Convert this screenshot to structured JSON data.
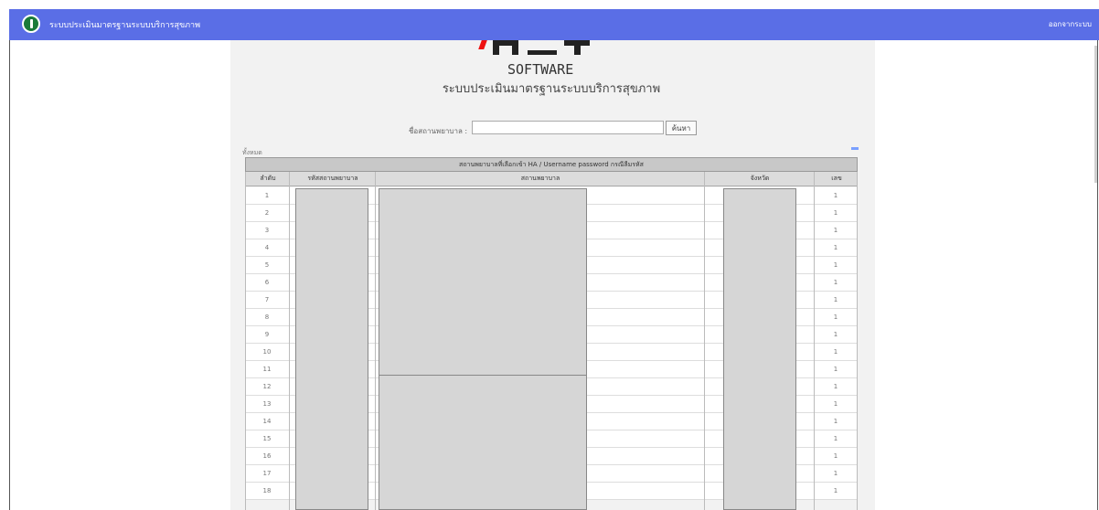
{
  "header": {
    "app_title": "ระบบประเมินมาตรฐานระบบบริการสุขภาพ",
    "top_right_link": "ออกจากระบบ",
    "accent_color": "#5a6ee6"
  },
  "brand": {
    "wordmark": "SOFTWARE",
    "subtitle": "ระบบประเมินมาตรฐานระบบบริการสุขภาพ"
  },
  "search": {
    "label": "ชื่อสถานพยาบาล :",
    "value": "",
    "placeholder": "",
    "button_label": "ค้นหา"
  },
  "table_meta": {
    "left_note": "ทั้งหมด",
    "title": "สถานพยาบาลที่เลือกเข้า HA / Username password กรณีลืมรหัส"
  },
  "table": {
    "columns": [
      "ลำดับ",
      "รหัสสถานพยาบาล",
      "สถานพยาบาล",
      "จังหวัด",
      "เลข"
    ],
    "rows": [
      {
        "no": "1",
        "count": "1"
      },
      {
        "no": "2",
        "count": "1"
      },
      {
        "no": "3",
        "count": "1"
      },
      {
        "no": "4",
        "count": "1"
      },
      {
        "no": "5",
        "count": "1"
      },
      {
        "no": "6",
        "count": "1"
      },
      {
        "no": "7",
        "count": "1"
      },
      {
        "no": "8",
        "count": "1"
      },
      {
        "no": "9",
        "count": "1"
      },
      {
        "no": "10",
        "count": "1"
      },
      {
        "no": "11",
        "count": "1"
      },
      {
        "no": "12",
        "count": "1"
      },
      {
        "no": "13",
        "count": "1"
      },
      {
        "no": "14",
        "count": "1"
      },
      {
        "no": "15",
        "count": "1"
      },
      {
        "no": "16",
        "count": "1"
      },
      {
        "no": "17",
        "count": "1"
      },
      {
        "no": "18",
        "count": "1"
      }
    ]
  }
}
